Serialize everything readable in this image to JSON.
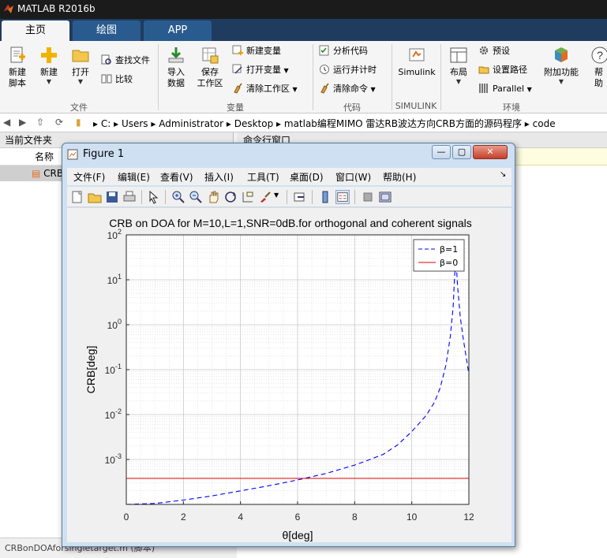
{
  "app": {
    "title": "MATLAB R2016b"
  },
  "ribbon_tabs": [
    {
      "label": "主页",
      "active": true
    },
    {
      "label": "绘图",
      "active": false
    },
    {
      "label": "APP",
      "active": false
    }
  ],
  "ribbon": {
    "file": {
      "group_label": "文件",
      "new_script": "新建\n脚本",
      "new": "新建",
      "open": "打开",
      "find_files": "查找文件",
      "compare": "比较"
    },
    "variable": {
      "group_label": "变量",
      "import_data": "导入\n数据",
      "save_workspace": "保存\n工作区",
      "new_variable": "新建变量",
      "open_variable": "打开变量",
      "clear_workspace": "清除工作区"
    },
    "code": {
      "group_label": "代码",
      "analyze_code": "分析代码",
      "run_and_time": "运行并计时",
      "clear_commands": "清除命令"
    },
    "simulink": {
      "group_label": "SIMULINK",
      "button": "Simulink"
    },
    "environment": {
      "group_label": "环境",
      "layout": "布局",
      "preferences": "预设",
      "set_path": "设置路径",
      "parallel": "Parallel",
      "addons": "附加功能",
      "help": "帮助"
    }
  },
  "address": {
    "crumbs": [
      "C:",
      "Users",
      "Administrator",
      "Desktop",
      "matlab编程MIMO 雷达RB波达方向CRB方面的源码程序",
      "code"
    ]
  },
  "current_folder": {
    "title": "当前文件夹",
    "column_name": "名称",
    "files": [
      "CRBon"
    ],
    "details": "CRBonDOAforsingletarget.m  (脚本)"
  },
  "command_window": {
    "title": "命令行窗口"
  },
  "figure": {
    "title": "Figure 1",
    "menu": [
      "文件(F)",
      "编辑(E)",
      "查看(V)",
      "插入(I)",
      "工具(T)",
      "桌面(D)",
      "窗口(W)",
      "帮助(H)"
    ]
  },
  "chart_data": {
    "type": "line",
    "title": "CRB on DOA for M=10,L=1,SNR=0dB.for orthogonal and coherent signals",
    "xlabel": "θ[deg]",
    "ylabel": "CRB[deg]",
    "xlim": [
      0,
      12
    ],
    "ylim": [
      0.0001,
      100
    ],
    "yscale": "log",
    "grid": true,
    "minor_grid": true,
    "legend_position": "top-right",
    "x_ticks": [
      0,
      2,
      4,
      6,
      8,
      10,
      12
    ],
    "y_ticks": [
      "10^-3",
      "10^-2",
      "10^-1",
      "10^0",
      "10^1",
      "10^2"
    ],
    "series": [
      {
        "name": "β=1",
        "style": "dashed",
        "color": "#0000ff",
        "x": [
          0,
          1,
          2,
          3,
          4,
          5,
          6,
          7,
          8,
          8.5,
          9,
          9.5,
          10,
          10.5,
          10.8,
          11,
          11.2,
          11.35,
          11.45,
          11.5,
          11.55,
          11.6,
          11.7,
          11.8,
          12
        ],
        "y": [
          0.0001,
          0.000105,
          0.000125,
          0.000155,
          0.0002,
          0.00026,
          0.00035,
          0.00049,
          0.00075,
          0.00098,
          0.0013,
          0.0021,
          0.0042,
          0.0095,
          0.019,
          0.04,
          0.13,
          0.55,
          2.5,
          12,
          30,
          8,
          1.5,
          0.5,
          0.08
        ]
      },
      {
        "name": "β=0",
        "style": "solid",
        "color": "#e00000",
        "x": [
          0,
          12
        ],
        "y": [
          0.00038,
          0.00038
        ]
      }
    ]
  }
}
